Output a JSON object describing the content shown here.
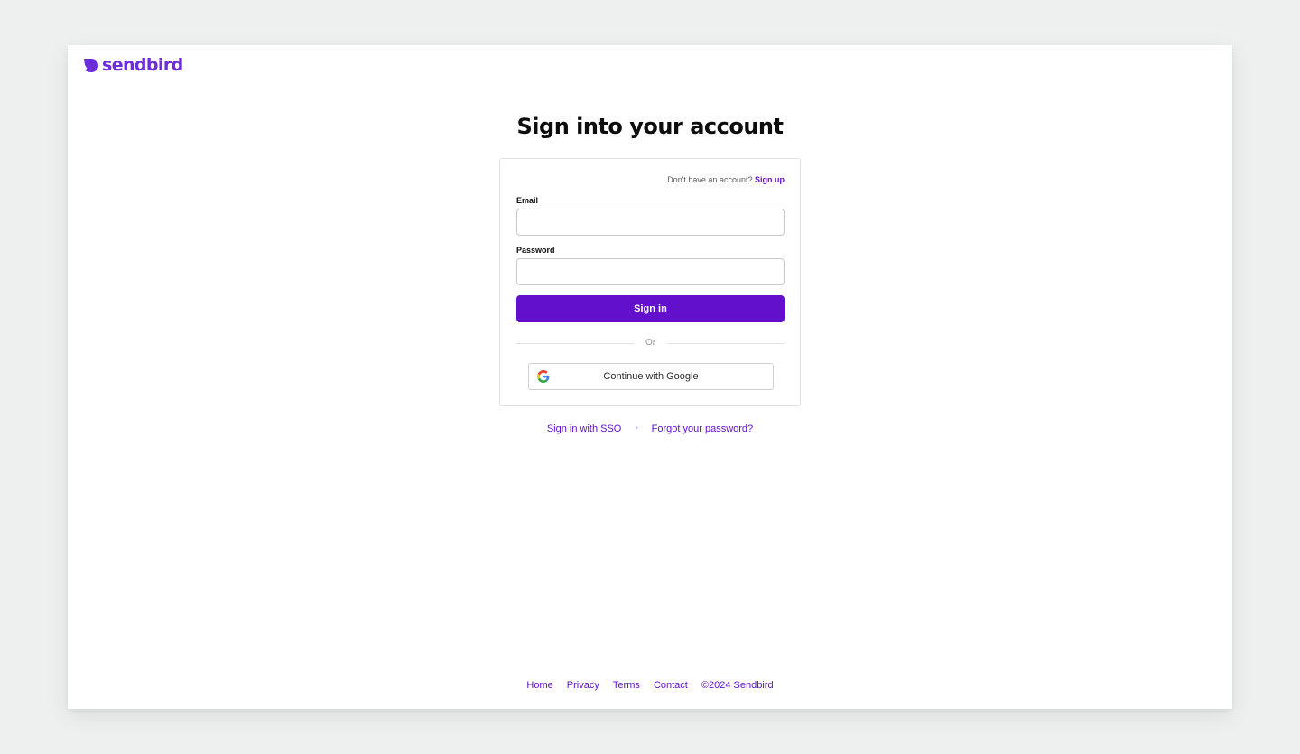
{
  "brand": {
    "name": "sendbird",
    "color": "#6c2cd8",
    "logo_icon": "sendbird-mark-icon"
  },
  "page": {
    "title": "Sign into your account"
  },
  "form": {
    "signup_prompt": "Don't have an account?",
    "signup_link": "Sign up",
    "email_label": "Email",
    "email_value": "",
    "email_placeholder": "",
    "password_label": "Password",
    "password_value": "",
    "password_placeholder": "",
    "submit_label": "Sign in",
    "divider_text": "Or",
    "google_label": "Continue with Google",
    "google_icon": "google-icon",
    "primary_color": "#6210cc"
  },
  "links": {
    "sso": "Sign in with SSO",
    "separator": "•",
    "forgot": "Forgot your password?"
  },
  "footer": {
    "items": [
      "Home",
      "Privacy",
      "Terms",
      "Contact"
    ],
    "copyright": "©2024 Sendbird"
  }
}
